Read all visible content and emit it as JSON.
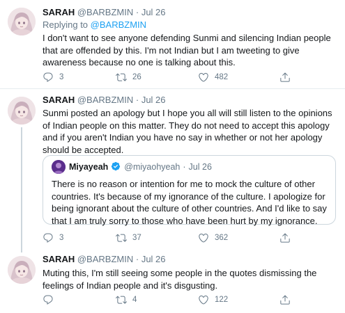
{
  "tweets": [
    {
      "name": "SARAH",
      "handle": "@BARBZMIN",
      "separator": "·",
      "date": "Jul 26",
      "replying_prefix": "Replying to ",
      "replying_to": "@BARBZMIN",
      "text": "I don't want to see anyone defending Sunmi and silencing Indian people that are offended by this. I'm not Indian but I am tweeting to give awareness because no one is talking about this.",
      "replies": "3",
      "retweets": "26",
      "likes": "482"
    },
    {
      "name": "SARAH",
      "handle": "@BARBZMIN",
      "separator": "·",
      "date": "Jul 26",
      "text": "Sunmi posted an apology but I hope you all will still listen to the opinions of Indian people on this matter. They do not need to accept this apology and if you aren't Indian you have no say in whether or not her apology should be accepted.",
      "quote": {
        "name": "Miyayeah",
        "handle": "@miyaohyeah",
        "separator": "·",
        "date": "Jul 26",
        "text": "There is no reason or intention for me to mock the culture of other countries. It's because of my ignorance of the culture. I apologize for being ignorant about the culture of other countries. And I'd like to say that I am truly sorry to those who have been hurt by my ignorance."
      },
      "replies": "3",
      "retweets": "37",
      "likes": "362"
    },
    {
      "name": "SARAH",
      "handle": "@BARBZMIN",
      "separator": "·",
      "date": "Jul 26",
      "text": "Muting this, I'm still seeing some people in the quotes dismissing the feelings of Indian people and it's disgusting.",
      "replies": "",
      "retweets": "4",
      "likes": "122"
    }
  ],
  "icons": {
    "reply": "reply-icon",
    "retweet": "retweet-icon",
    "like": "heart-icon",
    "share": "share-icon",
    "verified": "verified-badge-icon"
  },
  "colors": {
    "link": "#1da1f2",
    "secondary_text": "#657786",
    "border": "#ccd6dd"
  }
}
